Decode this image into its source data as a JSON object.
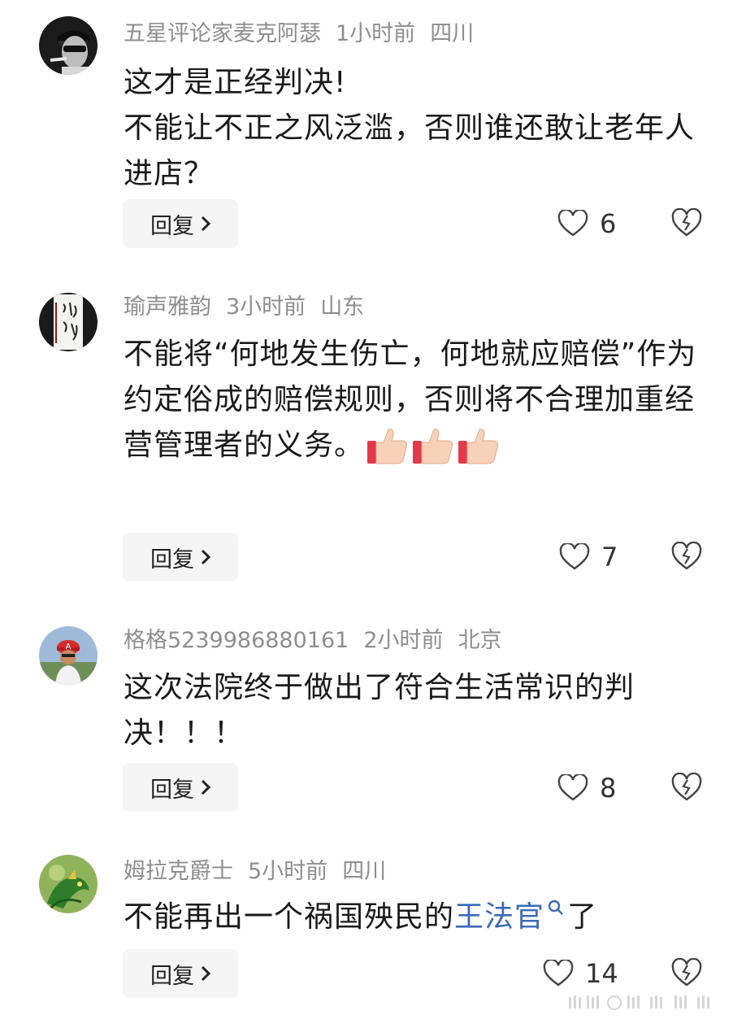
{
  "comments": [
    {
      "username": "五星评论家麦克阿瑟",
      "time": "1小时前",
      "location": "四川",
      "lines": [
        "这才是正经判决!",
        "不能让不正之风泛滥，否则谁还敢让老年人进店？"
      ],
      "reply_label": "回复",
      "likes": "6",
      "avatar_icon": "avatar-man-sunglasses-pipe"
    },
    {
      "username": "瑜声雅韵",
      "time": "3小时前",
      "location": "山东",
      "text": "不能将“何地发生伤亡，何地就应赔偿”作为约定俗成的赔偿规则，否则将不合理加重经营管理者的义务。",
      "reply_label": "回复",
      "likes": "7",
      "emoji": "thumbs-up",
      "avatar_icon": "avatar-calligraphy"
    },
    {
      "username": "格格5239986880161",
      "time": "2小时前",
      "location": "北京",
      "text": "这次法院终于做出了符合生活常识的判决！！！",
      "reply_label": "回复",
      "likes": "8",
      "avatar_icon": "avatar-person-red-cap"
    },
    {
      "username": "姆拉克爵士",
      "time": "5小时前",
      "location": "四川",
      "text_before": "不能再出一个祸国殃民的",
      "link": "王法官",
      "text_after": "了",
      "reply_label": "回复",
      "likes": "14",
      "avatar_icon": "avatar-green-dragon"
    }
  ],
  "colors": {
    "meta": "#8e8e8e",
    "text": "#1a1a1a",
    "link": "#3b6bb5",
    "reply_bg": "#f5f5f5"
  },
  "icons": {
    "like": "heart-outline-icon",
    "dislike": "broken-heart-icon",
    "search": "search-icon",
    "chevron": "chevron-right-icon"
  }
}
